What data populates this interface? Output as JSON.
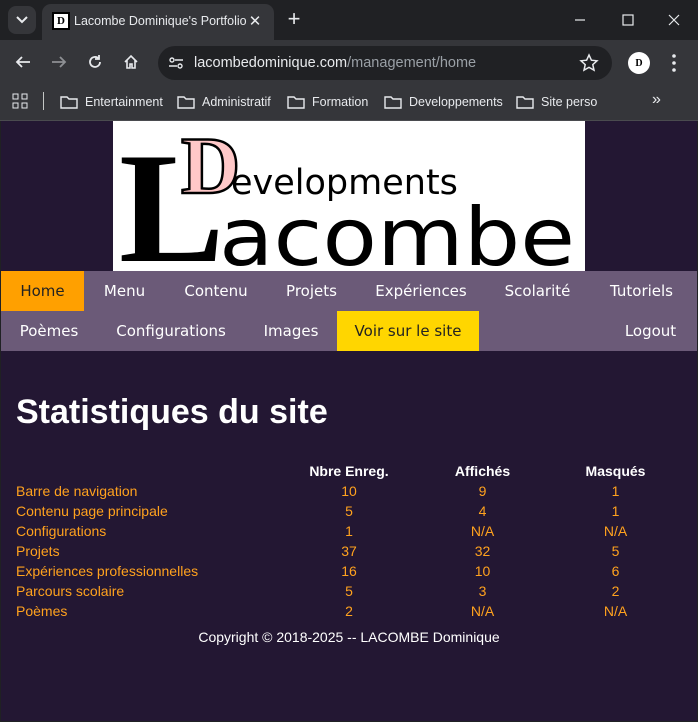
{
  "browser": {
    "tab_title": "Lacombe Dominique's Portfolio",
    "url_host": "lacombedominique.com",
    "url_path": "/management/home",
    "bookmarks": [
      "Entertainment",
      "Administratif",
      "Formation",
      "Developpements",
      "Site perso"
    ]
  },
  "site": {
    "logo_text_small": "evelopments",
    "logo_text_big": "acombe",
    "logo_letter_d": "D",
    "logo_letter_l": "L",
    "accent_active": "#ffa000",
    "accent_cta": "#ffd600",
    "nav_row1": [
      "Home",
      "Menu",
      "Contenu",
      "Projets",
      "Expériences",
      "Scolarité",
      "Tutoriels"
    ],
    "nav_row2": [
      "Poèmes",
      "Configurations",
      "Images",
      "Voir sur le site"
    ],
    "logout": "Logout",
    "title": "Statistiques du site",
    "table": {
      "headers": [
        "",
        "Nbre Enreg.",
        "Affichés",
        "Masqués"
      ],
      "rows": [
        [
          "Barre de navigation",
          "10",
          "9",
          "1"
        ],
        [
          "Contenu page principale",
          "5",
          "4",
          "1"
        ],
        [
          "Configurations",
          "1",
          "N/A",
          "N/A"
        ],
        [
          "Projets",
          "37",
          "32",
          "5"
        ],
        [
          "Expériences professionnelles",
          "16",
          "10",
          "6"
        ],
        [
          "Parcours scolaire",
          "5",
          "3",
          "2"
        ],
        [
          "Poèmes",
          "2",
          "N/A",
          "N/A"
        ]
      ]
    },
    "copyright": "Copyright © 2018-2025 -- LACOMBE Dominique"
  }
}
